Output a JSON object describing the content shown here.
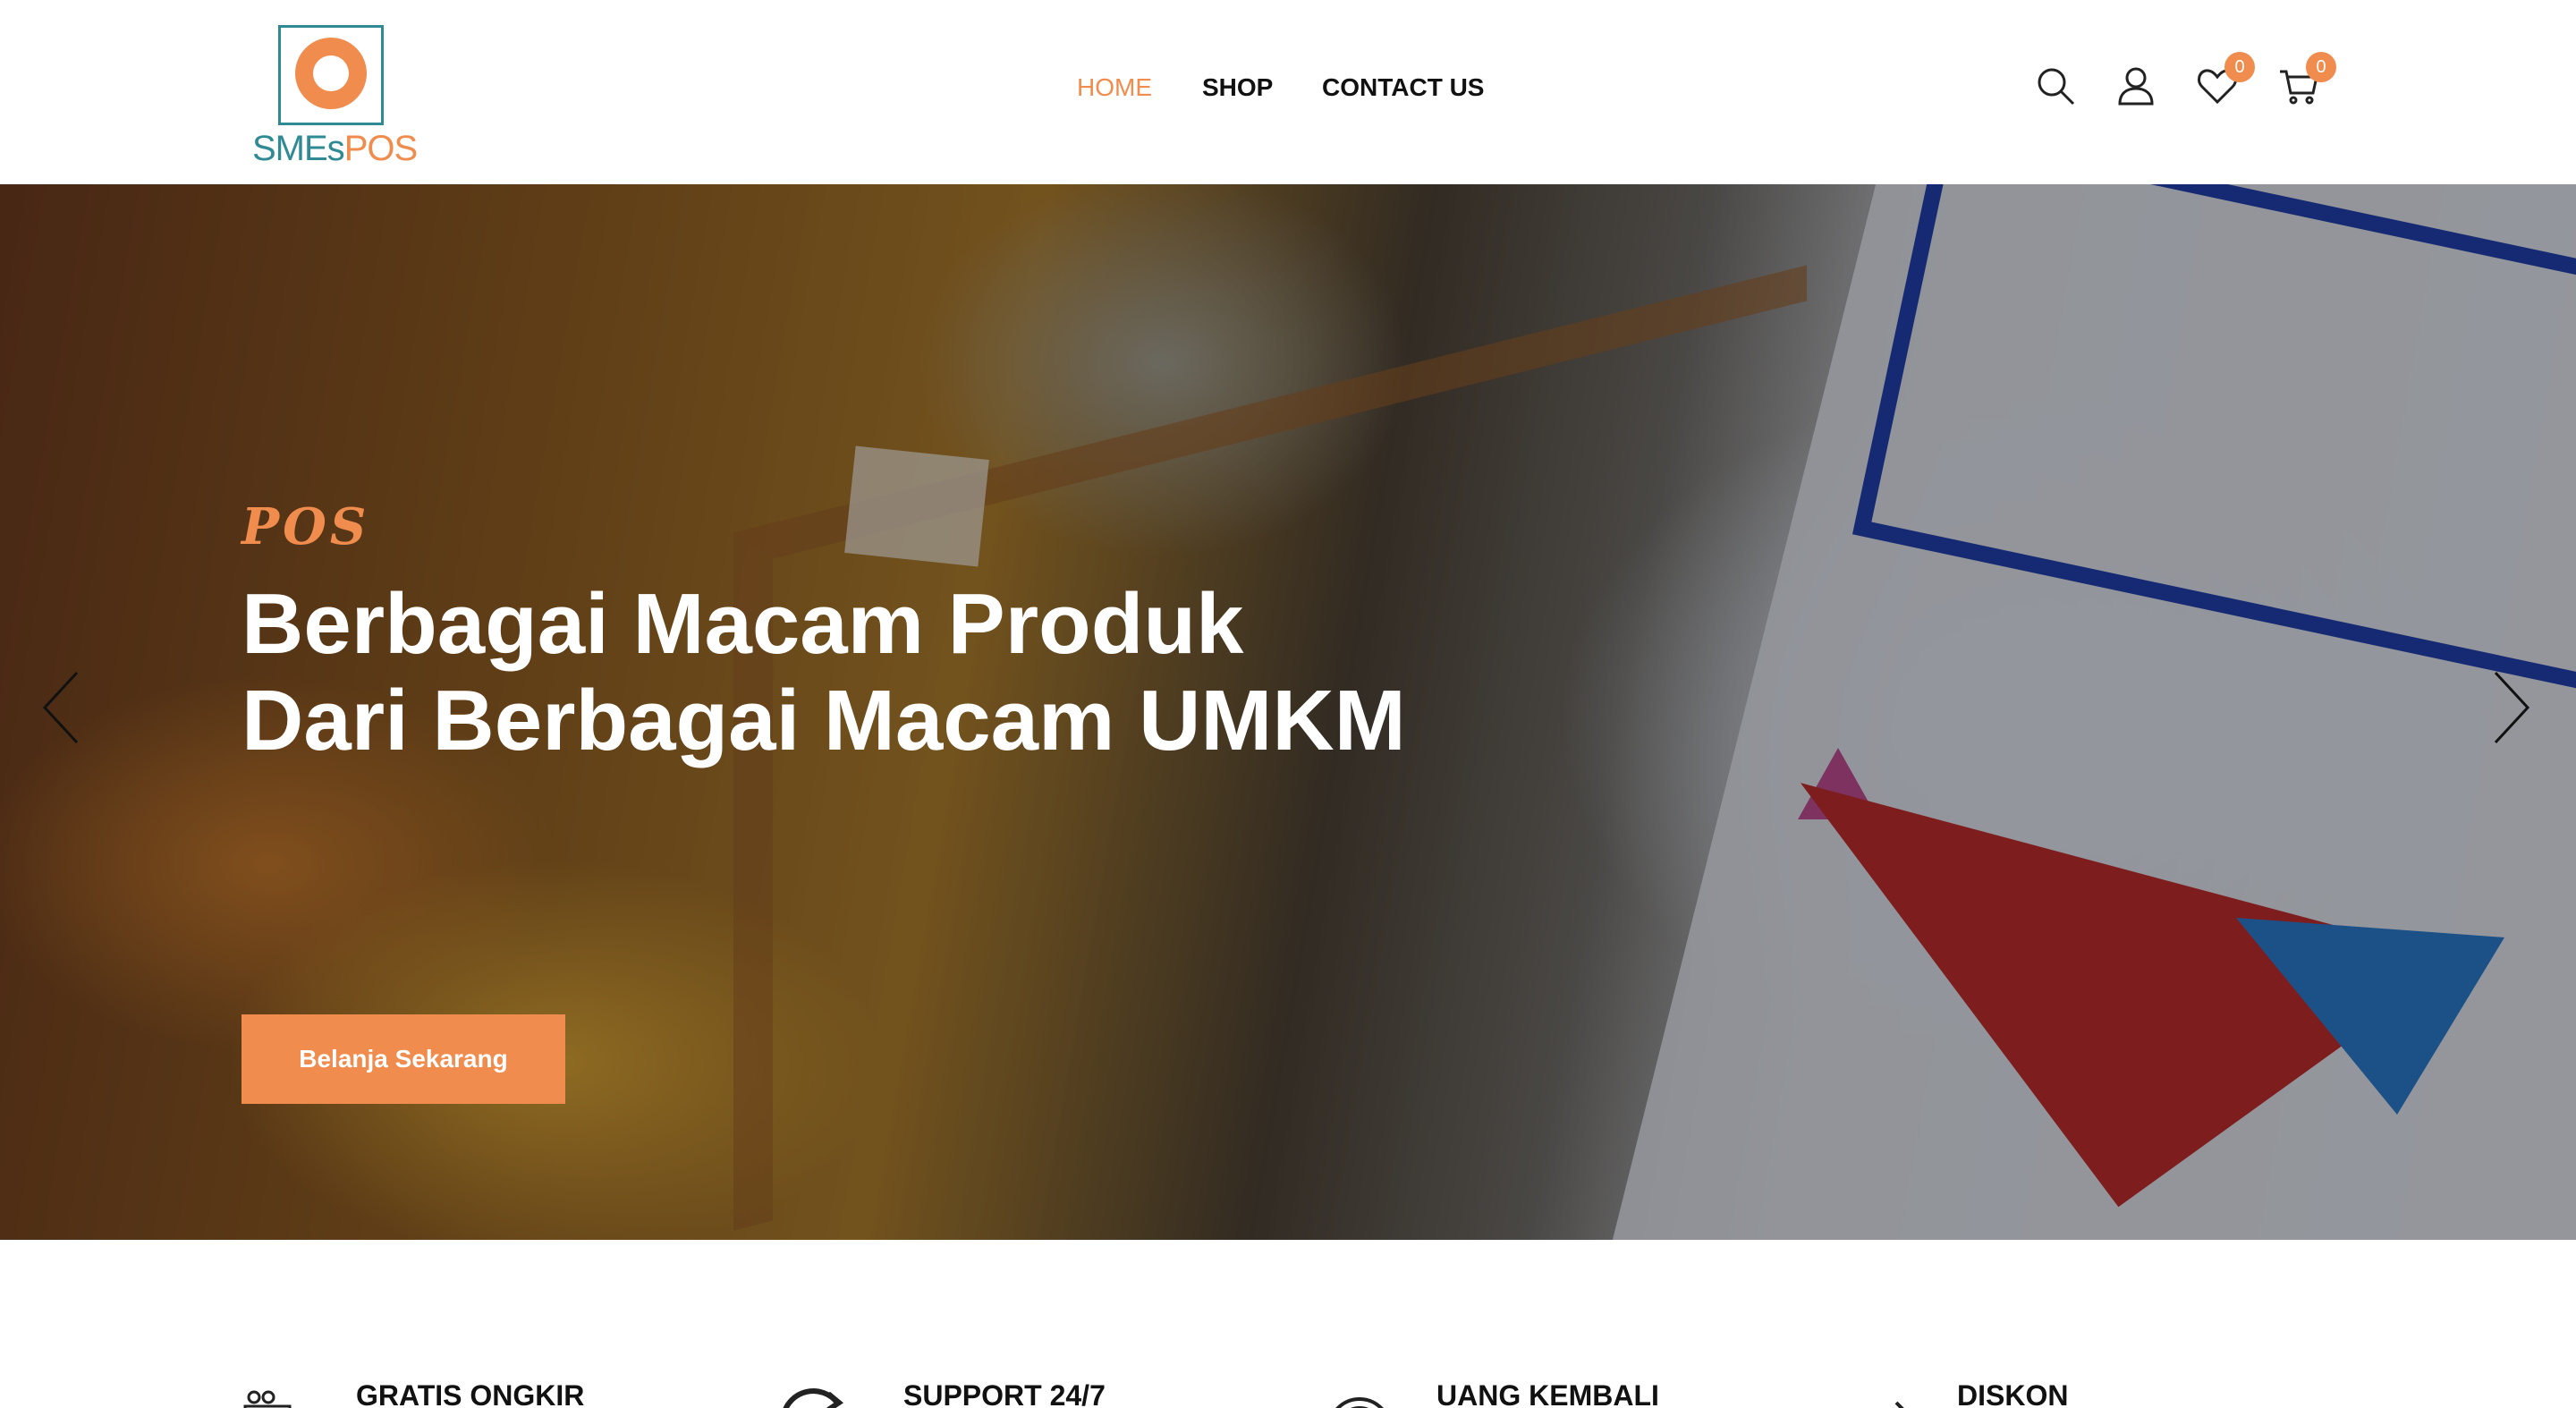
{
  "brand": {
    "logo_text_main": "SMEs",
    "logo_text_accent": "POS",
    "accent_color": "#f08c4e",
    "teal_color": "#2f8a94"
  },
  "nav": {
    "home": "HOME",
    "shop": "SHOP",
    "contact": "CONTACT US"
  },
  "header_icons": {
    "search": "search-icon",
    "account": "user-icon",
    "wishlist": "heart-icon",
    "cart": "cart-icon",
    "wishlist_count": "0",
    "cart_count": "0"
  },
  "hero": {
    "kicker": "POS",
    "title_line1": "Berbagai Macam Produk",
    "title_line2": "Dari Berbagai Macam UMKM",
    "button": "Belanja Sekarang"
  },
  "features": [
    {
      "title": "GRATIS ONGKIR",
      "icon": "delivery-icon"
    },
    {
      "title": "SUPPORT 24/7",
      "icon": "support-icon"
    },
    {
      "title": "UANG KEMBALI",
      "icon": "money-back-icon"
    },
    {
      "title": "DISKON",
      "icon": "discount-icon"
    }
  ]
}
